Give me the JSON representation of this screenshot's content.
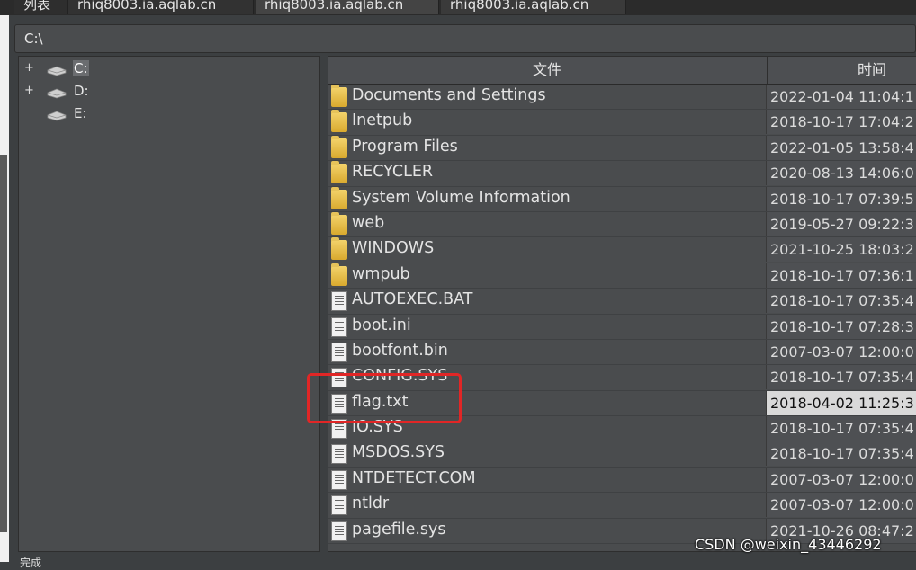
{
  "tabs": [
    {
      "label": "列表"
    },
    {
      "label": "rhiq8003.ia.aqlab.cn"
    },
    {
      "label": "rhiq8003.ia.aqlab.cn"
    },
    {
      "label": "rhiq8003.ia.aqlab.cn"
    }
  ],
  "path": "C:\\",
  "tree": [
    {
      "expander": "+",
      "label": "C:",
      "selected": true
    },
    {
      "expander": "+",
      "label": "D:",
      "selected": false
    },
    {
      "expander": "",
      "label": "E:",
      "selected": false
    }
  ],
  "columns": {
    "name": "文件",
    "time": "时间"
  },
  "files": [
    {
      "type": "folder",
      "name": "Documents and Settings",
      "time": "2022-01-04 11:04:1"
    },
    {
      "type": "folder",
      "name": "Inetpub",
      "time": "2018-10-17 17:04:2"
    },
    {
      "type": "folder",
      "name": "Program Files",
      "time": "2022-01-05 13:58:4"
    },
    {
      "type": "folder",
      "name": "RECYCLER",
      "time": "2020-08-13 14:06:0"
    },
    {
      "type": "folder",
      "name": "System Volume Information",
      "time": "2018-10-17 07:39:5"
    },
    {
      "type": "folder",
      "name": "web",
      "time": "2019-05-27 09:22:3"
    },
    {
      "type": "folder",
      "name": "WINDOWS",
      "time": "2021-10-25 18:03:2"
    },
    {
      "type": "folder",
      "name": "wmpub",
      "time": "2018-10-17 07:36:1"
    },
    {
      "type": "file",
      "name": "AUTOEXEC.BAT",
      "time": "2018-10-17 07:35:4"
    },
    {
      "type": "file",
      "name": "boot.ini",
      "time": "2018-10-17 07:28:3"
    },
    {
      "type": "file",
      "name": "bootfont.bin",
      "time": "2007-03-07 12:00:0"
    },
    {
      "type": "file",
      "name": "CONFIG.SYS",
      "time": "2018-10-17 07:35:4"
    },
    {
      "type": "file",
      "name": "flag.txt",
      "time": "2018-04-02 11:25:3",
      "selected": true
    },
    {
      "type": "file",
      "name": "IO.SYS",
      "time": "2018-10-17 07:35:4"
    },
    {
      "type": "file",
      "name": "MSDOS.SYS",
      "time": "2018-10-17 07:35:4"
    },
    {
      "type": "file",
      "name": "NTDETECT.COM",
      "time": "2007-03-07 12:00:0"
    },
    {
      "type": "file",
      "name": "ntldr",
      "time": "2007-03-07 12:00:0"
    },
    {
      "type": "file",
      "name": "pagefile.sys",
      "time": "2021-10-26 08:47:2"
    }
  ],
  "status": "完成",
  "watermark": "CSDN @weixin_43446292",
  "colors": {
    "highlight": "#e12626",
    "panel": "#4a4c4e",
    "background": "#3c3f41"
  }
}
